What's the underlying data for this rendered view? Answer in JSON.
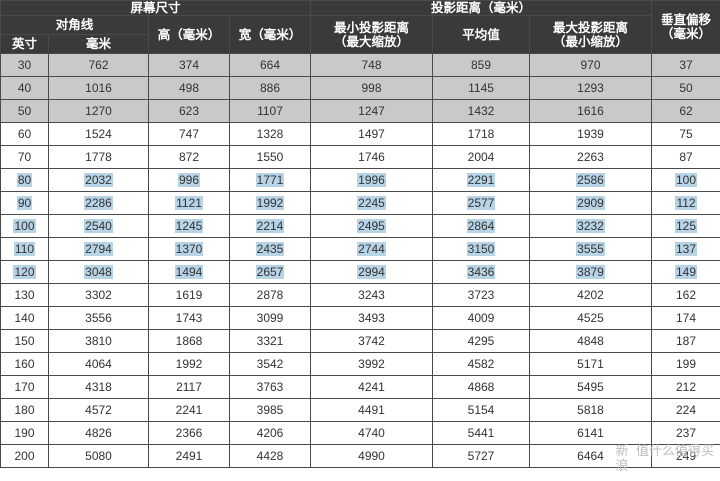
{
  "headers": {
    "screen_size": "屏幕尺寸",
    "projection_distance": "投影距离（毫米）",
    "vertical_offset": "垂直偏移（毫米）",
    "diagonal": "对角线",
    "height": "高（毫米）",
    "width": "宽（毫米）",
    "min_distance": "最小投影距离（最大缩放）",
    "average": "平均值",
    "max_distance": "最大投影距离（最小缩放）",
    "inch": "英寸",
    "mm": "毫米"
  },
  "rows": [
    {
      "inch": "30",
      "diag_mm": "762",
      "height": "374",
      "width": "664",
      "min": "748",
      "avg": "859",
      "max": "970",
      "offset": "37",
      "shade": "gray"
    },
    {
      "inch": "40",
      "diag_mm": "1016",
      "height": "498",
      "width": "886",
      "min": "998",
      "avg": "1145",
      "max": "1293",
      "offset": "50",
      "shade": "gray"
    },
    {
      "inch": "50",
      "diag_mm": "1270",
      "height": "623",
      "width": "1107",
      "min": "1247",
      "avg": "1432",
      "max": "1616",
      "offset": "62",
      "shade": "gray"
    },
    {
      "inch": "60",
      "diag_mm": "1524",
      "height": "747",
      "width": "1328",
      "min": "1497",
      "avg": "1718",
      "max": "1939",
      "offset": "75",
      "shade": "none"
    },
    {
      "inch": "70",
      "diag_mm": "1778",
      "height": "872",
      "width": "1550",
      "min": "1746",
      "avg": "2004",
      "max": "2263",
      "offset": "87",
      "shade": "none"
    },
    {
      "inch": "80",
      "diag_mm": "2032",
      "height": "996",
      "width": "1771",
      "min": "1996",
      "avg": "2291",
      "max": "2586",
      "offset": "100",
      "shade": "highlight"
    },
    {
      "inch": "90",
      "diag_mm": "2286",
      "height": "1121",
      "width": "1992",
      "min": "2245",
      "avg": "2577",
      "max": "2909",
      "offset": "112",
      "shade": "highlight"
    },
    {
      "inch": "100",
      "diag_mm": "2540",
      "height": "1245",
      "width": "2214",
      "min": "2495",
      "avg": "2864",
      "max": "3232",
      "offset": "125",
      "shade": "highlight"
    },
    {
      "inch": "110",
      "diag_mm": "2794",
      "height": "1370",
      "width": "2435",
      "min": "2744",
      "avg": "3150",
      "max": "3555",
      "offset": "137",
      "shade": "highlight"
    },
    {
      "inch": "120",
      "diag_mm": "3048",
      "height": "1494",
      "width": "2657",
      "min": "2994",
      "avg": "3436",
      "max": "3879",
      "offset": "149",
      "shade": "highlight"
    },
    {
      "inch": "130",
      "diag_mm": "3302",
      "height": "1619",
      "width": "2878",
      "min": "3243",
      "avg": "3723",
      "max": "4202",
      "offset": "162",
      "shade": "none"
    },
    {
      "inch": "140",
      "diag_mm": "3556",
      "height": "1743",
      "width": "3099",
      "min": "3493",
      "avg": "4009",
      "max": "4525",
      "offset": "174",
      "shade": "none"
    },
    {
      "inch": "150",
      "diag_mm": "3810",
      "height": "1868",
      "width": "3321",
      "min": "3742",
      "avg": "4295",
      "max": "4848",
      "offset": "187",
      "shade": "none"
    },
    {
      "inch": "160",
      "diag_mm": "4064",
      "height": "1992",
      "width": "3542",
      "min": "3992",
      "avg": "4582",
      "max": "5171",
      "offset": "199",
      "shade": "none"
    },
    {
      "inch": "170",
      "diag_mm": "4318",
      "height": "2117",
      "width": "3763",
      "min": "4241",
      "avg": "4868",
      "max": "5495",
      "offset": "212",
      "shade": "none"
    },
    {
      "inch": "180",
      "diag_mm": "4572",
      "height": "2241",
      "width": "3985",
      "min": "4491",
      "avg": "5154",
      "max": "5818",
      "offset": "224",
      "shade": "none"
    },
    {
      "inch": "190",
      "diag_mm": "4826",
      "height": "2366",
      "width": "4206",
      "min": "4740",
      "avg": "5441",
      "max": "6141",
      "offset": "237",
      "shade": "none"
    },
    {
      "inch": "200",
      "diag_mm": "5080",
      "height": "2491",
      "width": "4428",
      "min": "4990",
      "avg": "5727",
      "max": "6464",
      "offset": "249",
      "shade": "none"
    }
  ],
  "colors": {
    "header_bg": "#3a3a3a",
    "gray_row": "#c9c9c9",
    "highlight": "#b7d3e6"
  },
  "watermark": {
    "line1": "新",
    "line2": "浪",
    "text": "值",
    "suffix": "什么值得买"
  }
}
